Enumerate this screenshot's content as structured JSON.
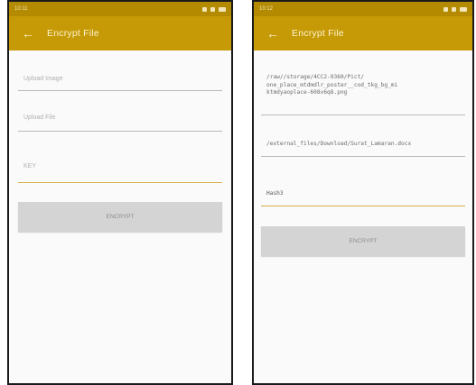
{
  "left_screen": {
    "status": {
      "time": "10:11",
      "icons_right": "···"
    },
    "toolbar": {
      "title": "Encrypt File"
    },
    "fields": {
      "upload_image_placeholder": "Upload Image",
      "upload_file_placeholder": "Upload File",
      "key_placeholder": "KEY"
    },
    "button_label": "ENCRYPT"
  },
  "right_screen": {
    "status": {
      "time": "10:12",
      "icons_right": "···"
    },
    "toolbar": {
      "title": "Encrypt File"
    },
    "fields": {
      "image_path_line1": "/raw//storage/4CC2-9360/Pict/",
      "image_path_line2": "one_place_mtdmdlr_poster__cod_tkg_bg_mi",
      "image_path_line3": "ktmdyaoplace-608v6q8.png",
      "file_path": "/external_files/Download/Surat_Lamaran.docx",
      "key_value": "Hash3"
    },
    "button_label": "ENCRYPT"
  },
  "colors": {
    "toolbar": "#c69a07",
    "statusbar": "#b38a00",
    "active_underline": "#d8b04a",
    "button_bg": "#d4d4d4"
  },
  "icons": [
    "back-arrow-icon",
    "wifi-icon",
    "signal-icon",
    "battery-icon"
  ]
}
